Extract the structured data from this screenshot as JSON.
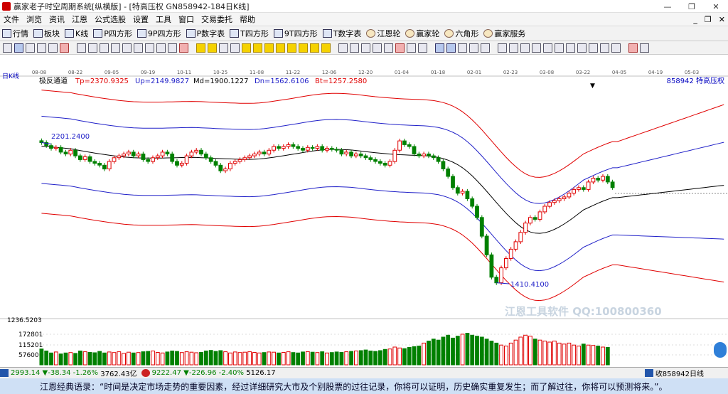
{
  "window": {
    "title": "赢家老子时空周期系统[纵横版] - [特高压权  GN858942-184日K线]",
    "controls": [
      "—",
      "❐",
      "✕"
    ]
  },
  "menu": {
    "items": [
      "文件",
      "浏览",
      "资讯",
      "江恩",
      "公式选股",
      "设置",
      "工具",
      "窗口",
      "交易委托",
      "帮助"
    ],
    "mdi": [
      "_",
      "❐",
      "✕"
    ]
  },
  "toolbar": {
    "items": [
      "行情",
      "板块",
      "K线",
      "P四方形",
      "9P四方形",
      "P数字表",
      "T四方形",
      "9T四方形",
      "T数字表",
      "江恩轮",
      "赢家轮",
      "六角形",
      "赢家服务"
    ]
  },
  "chart": {
    "period_label": "日K线",
    "indicator_name": "极反通道",
    "tp": "Tp=2370.9325",
    "up": "Up=2149.9827",
    "md": "Md=1900.1227",
    "dn": "Dn=1562.6106",
    "bt": "Bt=1257.2580",
    "symbol": "858942 特高压权",
    "date_ticks": [
      "08-08",
      "08-22",
      "09-05",
      "09-19",
      "10-11",
      "10-25",
      "11-08",
      "11-22",
      "12-06",
      "12-20",
      "01-04",
      "01-18",
      "02-01",
      "02-23",
      "03-08",
      "03-22",
      "04-05",
      "04-19",
      "05-03"
    ],
    "high_label": "2201.2400",
    "low_label": "1410.4100",
    "volume_ticks": [
      "1236.5203",
      "172801",
      "115201",
      "57600"
    ],
    "colors": {
      "tp": "#e00000",
      "up": "#2020c8",
      "md": "#000000",
      "up_candle": "#e00000",
      "down_candle": "#008000"
    }
  },
  "chart_data": {
    "type": "candlestick",
    "price_ylim": [
      1300,
      2500
    ],
    "closes": [
      2201,
      2185,
      2170,
      2175,
      2150,
      2140,
      2160,
      2130,
      2110,
      2125,
      2100,
      2090,
      2080,
      2060,
      2100,
      2120,
      2130,
      2140,
      2150,
      2130,
      2140,
      2110,
      2100,
      2120,
      2130,
      2150,
      2140,
      2100,
      2080,
      2090,
      2130,
      2150,
      2160,
      2140,
      2120,
      2100,
      2080,
      2050,
      2060,
      2090,
      2100,
      2110,
      2120,
      2130,
      2140,
      2150,
      2140,
      2160,
      2180,
      2170,
      2180,
      2190,
      2180,
      2170,
      2160,
      2175,
      2170,
      2180,
      2160,
      2170,
      2165,
      2160,
      2140,
      2150,
      2130,
      2140,
      2130,
      2120,
      2110,
      2100,
      2090,
      2080,
      2100,
      2160,
      2210,
      2190,
      2180,
      2140,
      2130,
      2140,
      2130,
      2120,
      2100,
      2060,
      2020,
      1960,
      1930,
      1940,
      1900,
      1860,
      1800,
      1700,
      1600,
      1480,
      1450,
      1530,
      1580,
      1630,
      1670,
      1720,
      1770,
      1800,
      1790,
      1830,
      1860,
      1880,
      1890,
      1900,
      1910,
      1930,
      1950,
      1960,
      1950,
      1990,
      2010,
      2000,
      2020,
      1990,
      1960
    ],
    "volume_ylim": [
      0,
      230000
    ],
    "volumes": [
      80000,
      70000,
      60000,
      65000,
      55000,
      60000,
      62000,
      58000,
      70000,
      66000,
      63000,
      61000,
      68000,
      60000,
      65000,
      62000,
      66000,
      58000,
      64000,
      60000,
      62000,
      66000,
      68000,
      70000,
      63000,
      60000,
      65000,
      70000,
      68000,
      62000,
      66000,
      64000,
      61000,
      63000,
      70000,
      73000,
      68000,
      72000,
      66000,
      60000,
      65000,
      62000,
      64000,
      66000,
      63000,
      60000,
      62000,
      65000,
      64000,
      60000,
      63000,
      66000,
      62000,
      60000,
      65000,
      67000,
      64000,
      62000,
      66000,
      60000,
      62000,
      65000,
      63000,
      66000,
      68000,
      70000,
      72000,
      75000,
      70000,
      68000,
      72000,
      78000,
      80000,
      90000,
      85000,
      82000,
      88000,
      92000,
      95000,
      110000,
      120000,
      130000,
      125000,
      140000,
      150000,
      135000,
      145000,
      155000,
      160000,
      150000,
      145000,
      140000,
      130000,
      120000,
      110000,
      100000,
      95000,
      110000,
      125000,
      140000,
      150000,
      145000,
      130000,
      125000,
      120000,
      115000,
      120000,
      110000,
      105000,
      110000,
      100000,
      95000,
      105000,
      100000,
      98000,
      95000,
      90000,
      88000
    ]
  },
  "status": {
    "idx1_value": "2993.14",
    "idx1_change": "▼-38.34",
    "idx1_pct": "-1.26%",
    "idx1_amount": "3762.43亿",
    "idx2_value": "9222.47",
    "idx2_change": "▼-226.96",
    "idx2_pct": "-2.40%",
    "idx2_amount": "5126.17",
    "right_text": "收858942日线"
  },
  "quote": {
    "text": "江恩经典语录：“时间是决定市场走势的重要因素，经过详细研究大市及个别股票的过往记录，你将可以证明，历史确实重复发生；而了解过往，你将可以预测将来。”。"
  },
  "watermark": {
    "line1": "江恩工具软件  QQ:100800360"
  }
}
